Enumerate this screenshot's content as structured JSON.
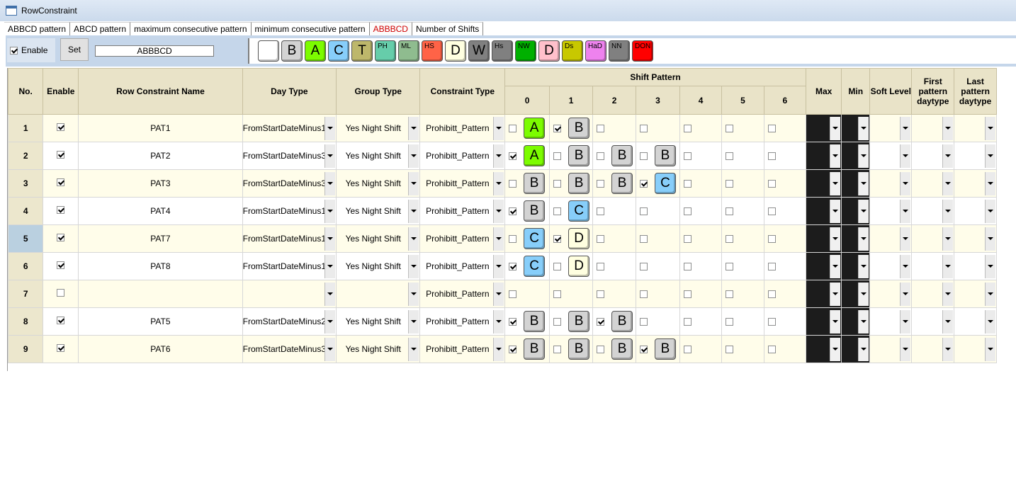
{
  "window": {
    "title": "RowConstraint"
  },
  "tabs": [
    {
      "label": "ABBCD pattern"
    },
    {
      "label": "ABCD pattern"
    },
    {
      "label": "maximum consecutive pattern"
    },
    {
      "label": "minimum consecutive pattern"
    },
    {
      "label": "ABBBCD"
    },
    {
      "label": "Number of Shifts"
    }
  ],
  "toolbar": {
    "enable_label": "Enable",
    "enable_checked": true,
    "set_label": "Set",
    "pattern_value": "ABBBCD"
  },
  "palette": [
    {
      "label": "",
      "color": "#ffffff",
      "small": false
    },
    {
      "label": "B",
      "color": "#d3d3d3",
      "small": false
    },
    {
      "label": "A",
      "color": "#7cfc00",
      "small": false
    },
    {
      "label": "C",
      "color": "#87cefa",
      "small": false
    },
    {
      "label": "T",
      "color": "#bdb76b",
      "small": false
    },
    {
      "label": "PH",
      "color": "#66cdaa",
      "small": true
    },
    {
      "label": "ML",
      "color": "#8fbc8f",
      "small": true
    },
    {
      "label": "HS",
      "color": "#ff6347",
      "small": true
    },
    {
      "label": "D",
      "color": "#ffffe0",
      "small": false
    },
    {
      "label": "W",
      "color": "#808080",
      "small": false
    },
    {
      "label": "Hs",
      "color": "#808080",
      "small": true
    },
    {
      "label": "NW",
      "color": "#00b000",
      "small": true
    },
    {
      "label": "D",
      "color": "#ffc0cb",
      "small": false
    },
    {
      "label": "Ds",
      "color": "#c8c800",
      "small": true
    },
    {
      "label": "HaD",
      "color": "#ee82ee",
      "small": true
    },
    {
      "label": "NN",
      "color": "#808080",
      "small": true
    },
    {
      "label": "DON",
      "color": "#ff0000",
      "small": true
    }
  ],
  "columns": {
    "no": "No.",
    "enable": "Enable",
    "name": "Row Constraint Name",
    "day_type": "Day Type",
    "group_type": "Group Type",
    "constraint_type": "Constraint Type",
    "shift_pattern": "Shift Pattern",
    "days": [
      "0",
      "1",
      "2",
      "3",
      "4",
      "5",
      "6"
    ],
    "max": "Max",
    "min": "Min",
    "soft_level": "Soft Level",
    "first_daytype": "First pattern daytype",
    "last_daytype": "Last pattern daytype"
  },
  "shift_colors": {
    "A": "#7cfc00",
    "B": "#d3d3d3",
    "C": "#87cefa",
    "D": "#ffffe0"
  },
  "rows": [
    {
      "no": "1",
      "enabled": true,
      "name": "PAT1",
      "day_type": "FromStartDateMinus1",
      "group_type": "Yes Night Shift",
      "constraint_type": "Prohibitt_Pattern",
      "pattern": [
        {
          "checked": false,
          "shift": "A"
        },
        {
          "checked": true,
          "shift": "B"
        },
        {
          "checked": false,
          "shift": ""
        },
        {
          "checked": false,
          "shift": ""
        },
        {
          "checked": false,
          "shift": ""
        },
        {
          "checked": false,
          "shift": ""
        },
        {
          "checked": false,
          "shift": ""
        }
      ]
    },
    {
      "no": "2",
      "enabled": true,
      "name": "PAT2",
      "day_type": "FromStartDateMinus3",
      "group_type": "Yes Night Shift",
      "constraint_type": "Prohibitt_Pattern",
      "pattern": [
        {
          "checked": true,
          "shift": "A"
        },
        {
          "checked": false,
          "shift": "B"
        },
        {
          "checked": false,
          "shift": "B"
        },
        {
          "checked": false,
          "shift": "B"
        },
        {
          "checked": false,
          "shift": ""
        },
        {
          "checked": false,
          "shift": ""
        },
        {
          "checked": false,
          "shift": ""
        }
      ]
    },
    {
      "no": "3",
      "enabled": true,
      "name": "PAT3",
      "day_type": "FromStartDateMinus3",
      "group_type": "Yes Night Shift",
      "constraint_type": "Prohibitt_Pattern",
      "pattern": [
        {
          "checked": false,
          "shift": "B"
        },
        {
          "checked": false,
          "shift": "B"
        },
        {
          "checked": false,
          "shift": "B"
        },
        {
          "checked": true,
          "shift": "C"
        },
        {
          "checked": false,
          "shift": ""
        },
        {
          "checked": false,
          "shift": ""
        },
        {
          "checked": false,
          "shift": ""
        }
      ]
    },
    {
      "no": "4",
      "enabled": true,
      "name": "PAT4",
      "day_type": "FromStartDateMinus1",
      "group_type": "Yes Night Shift",
      "constraint_type": "Prohibitt_Pattern",
      "pattern": [
        {
          "checked": true,
          "shift": "B"
        },
        {
          "checked": false,
          "shift": "C"
        },
        {
          "checked": false,
          "shift": ""
        },
        {
          "checked": false,
          "shift": ""
        },
        {
          "checked": false,
          "shift": ""
        },
        {
          "checked": false,
          "shift": ""
        },
        {
          "checked": false,
          "shift": ""
        }
      ]
    },
    {
      "no": "5",
      "enabled": true,
      "name": "PAT7",
      "day_type": "FromStartDateMinus1",
      "group_type": "Yes Night Shift",
      "constraint_type": "Prohibitt_Pattern",
      "selected": true,
      "pattern": [
        {
          "checked": false,
          "shift": "C"
        },
        {
          "checked": true,
          "shift": "D"
        },
        {
          "checked": false,
          "shift": ""
        },
        {
          "checked": false,
          "shift": ""
        },
        {
          "checked": false,
          "shift": ""
        },
        {
          "checked": false,
          "shift": ""
        },
        {
          "checked": false,
          "shift": ""
        }
      ]
    },
    {
      "no": "6",
      "enabled": true,
      "name": "PAT8",
      "day_type": "FromStartDateMinus1",
      "group_type": "Yes Night Shift",
      "constraint_type": "Prohibitt_Pattern",
      "pattern": [
        {
          "checked": true,
          "shift": "C"
        },
        {
          "checked": false,
          "shift": "D"
        },
        {
          "checked": false,
          "shift": ""
        },
        {
          "checked": false,
          "shift": ""
        },
        {
          "checked": false,
          "shift": ""
        },
        {
          "checked": false,
          "shift": ""
        },
        {
          "checked": false,
          "shift": ""
        }
      ]
    },
    {
      "no": "7",
      "enabled": false,
      "name": "",
      "day_type": "",
      "group_type": "",
      "constraint_type": "Prohibitt_Pattern",
      "pattern": [
        {
          "checked": false,
          "shift": ""
        },
        {
          "checked": false,
          "shift": ""
        },
        {
          "checked": false,
          "shift": ""
        },
        {
          "checked": false,
          "shift": ""
        },
        {
          "checked": false,
          "shift": ""
        },
        {
          "checked": false,
          "shift": ""
        },
        {
          "checked": false,
          "shift": ""
        }
      ]
    },
    {
      "no": "8",
      "enabled": true,
      "name": "PAT5",
      "day_type": "FromStartDateMinus2",
      "group_type": "Yes Night Shift",
      "constraint_type": "Prohibitt_Pattern",
      "pattern": [
        {
          "checked": true,
          "shift": "B"
        },
        {
          "checked": false,
          "shift": "B"
        },
        {
          "checked": true,
          "shift": "B"
        },
        {
          "checked": false,
          "shift": ""
        },
        {
          "checked": false,
          "shift": ""
        },
        {
          "checked": false,
          "shift": ""
        },
        {
          "checked": false,
          "shift": ""
        }
      ]
    },
    {
      "no": "9",
      "enabled": true,
      "name": "PAT6",
      "day_type": "FromStartDateMinus3",
      "group_type": "Yes Night Shift",
      "constraint_type": "Prohibitt_Pattern",
      "pattern": [
        {
          "checked": true,
          "shift": "B"
        },
        {
          "checked": false,
          "shift": "B"
        },
        {
          "checked": false,
          "shift": "B"
        },
        {
          "checked": true,
          "shift": "B"
        },
        {
          "checked": false,
          "shift": ""
        },
        {
          "checked": false,
          "shift": ""
        },
        {
          "checked": false,
          "shift": ""
        }
      ]
    }
  ]
}
